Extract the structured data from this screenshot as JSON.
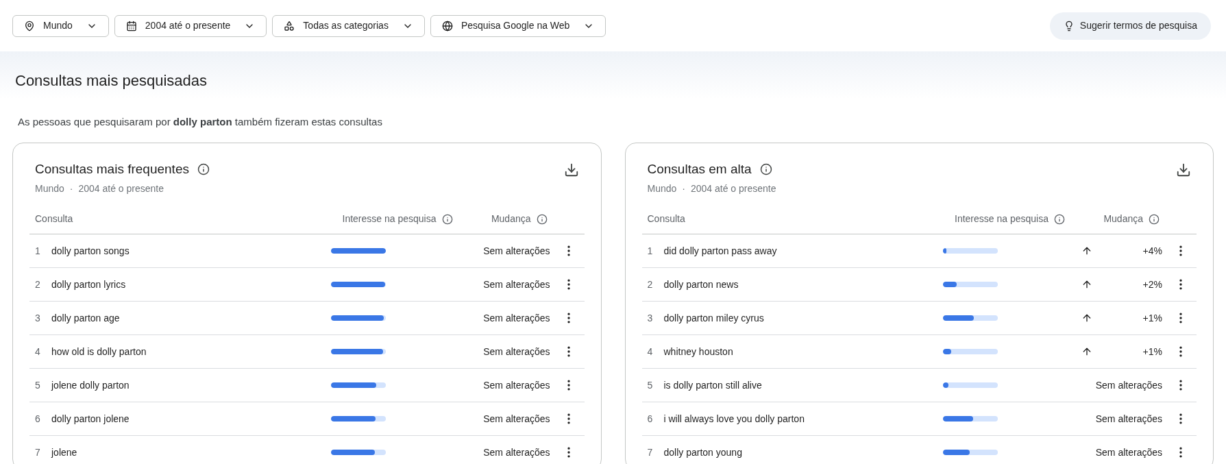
{
  "filters": [
    {
      "label": "Mundo"
    },
    {
      "label": "2004 até o presente"
    },
    {
      "label": "Todas as categorias"
    },
    {
      "label": "Pesquisa Google na Web"
    }
  ],
  "suggest_button": "Sugerir termos de pesquisa",
  "section_title": "Consultas mais pesquisadas",
  "intro": "As pessoas que pesquisaram por **dolly parton** também fizeram estas consultas",
  "cards": [
    {
      "title": "Consultas mais frequentes",
      "meta": [
        "Mundo",
        "·",
        "2004 até o presente"
      ],
      "columns": [
        "Consulta",
        "Interesse na pesquisa",
        "Mudança"
      ],
      "rows": [
        {
          "rank": "1",
          "query": "dolly parton songs",
          "level": 1.0,
          "change": {
            "kind": "none",
            "text": "Sem alterações"
          }
        },
        {
          "rank": "2",
          "query": "dolly parton lyrics",
          "level": 0.99,
          "change": {
            "kind": "none",
            "text": "Sem alterações"
          }
        },
        {
          "rank": "3",
          "query": "dolly parton age",
          "level": 0.97,
          "change": {
            "kind": "none",
            "text": "Sem alterações"
          }
        },
        {
          "rank": "4",
          "query": "how old is dolly parton",
          "level": 0.95,
          "change": {
            "kind": "none",
            "text": "Sem alterações"
          }
        },
        {
          "rank": "5",
          "query": "jolene dolly parton",
          "level": 0.83,
          "change": {
            "kind": "none",
            "text": "Sem alterações"
          }
        },
        {
          "rank": "6",
          "query": "dolly parton jolene",
          "level": 0.82,
          "change": {
            "kind": "none",
            "text": "Sem alterações"
          }
        },
        {
          "rank": "7",
          "query": "jolene",
          "level": 0.8,
          "change": {
            "kind": "none",
            "text": "Sem alterações"
          }
        }
      ]
    },
    {
      "title": "Consultas em alta",
      "meta": [
        "Mundo",
        "·",
        "2004 até o presente"
      ],
      "columns": [
        "Consulta",
        "Interesse na pesquisa",
        "Mudança"
      ],
      "rows": [
        {
          "rank": "1",
          "query": "did dolly parton pass away",
          "level": 0.06,
          "change": {
            "kind": "up",
            "text": "+4%"
          }
        },
        {
          "rank": "2",
          "query": "dolly parton news",
          "level": 0.25,
          "change": {
            "kind": "up",
            "text": "+2%"
          }
        },
        {
          "rank": "3",
          "query": "dolly parton miley cyrus",
          "level": 0.56,
          "change": {
            "kind": "up",
            "text": "+1%"
          }
        },
        {
          "rank": "4",
          "query": "whitney houston",
          "level": 0.15,
          "change": {
            "kind": "up",
            "text": "+1%"
          }
        },
        {
          "rank": "5",
          "query": "is dolly parton still alive",
          "level": 0.1,
          "change": {
            "kind": "none",
            "text": "Sem alterações"
          }
        },
        {
          "rank": "6",
          "query": "i will always love you dolly parton",
          "level": 0.55,
          "change": {
            "kind": "none",
            "text": "Sem alterações"
          }
        },
        {
          "rank": "7",
          "query": "dolly parton young",
          "level": 0.49,
          "change": {
            "kind": "none",
            "text": "Sem alterações"
          }
        }
      ]
    }
  ]
}
